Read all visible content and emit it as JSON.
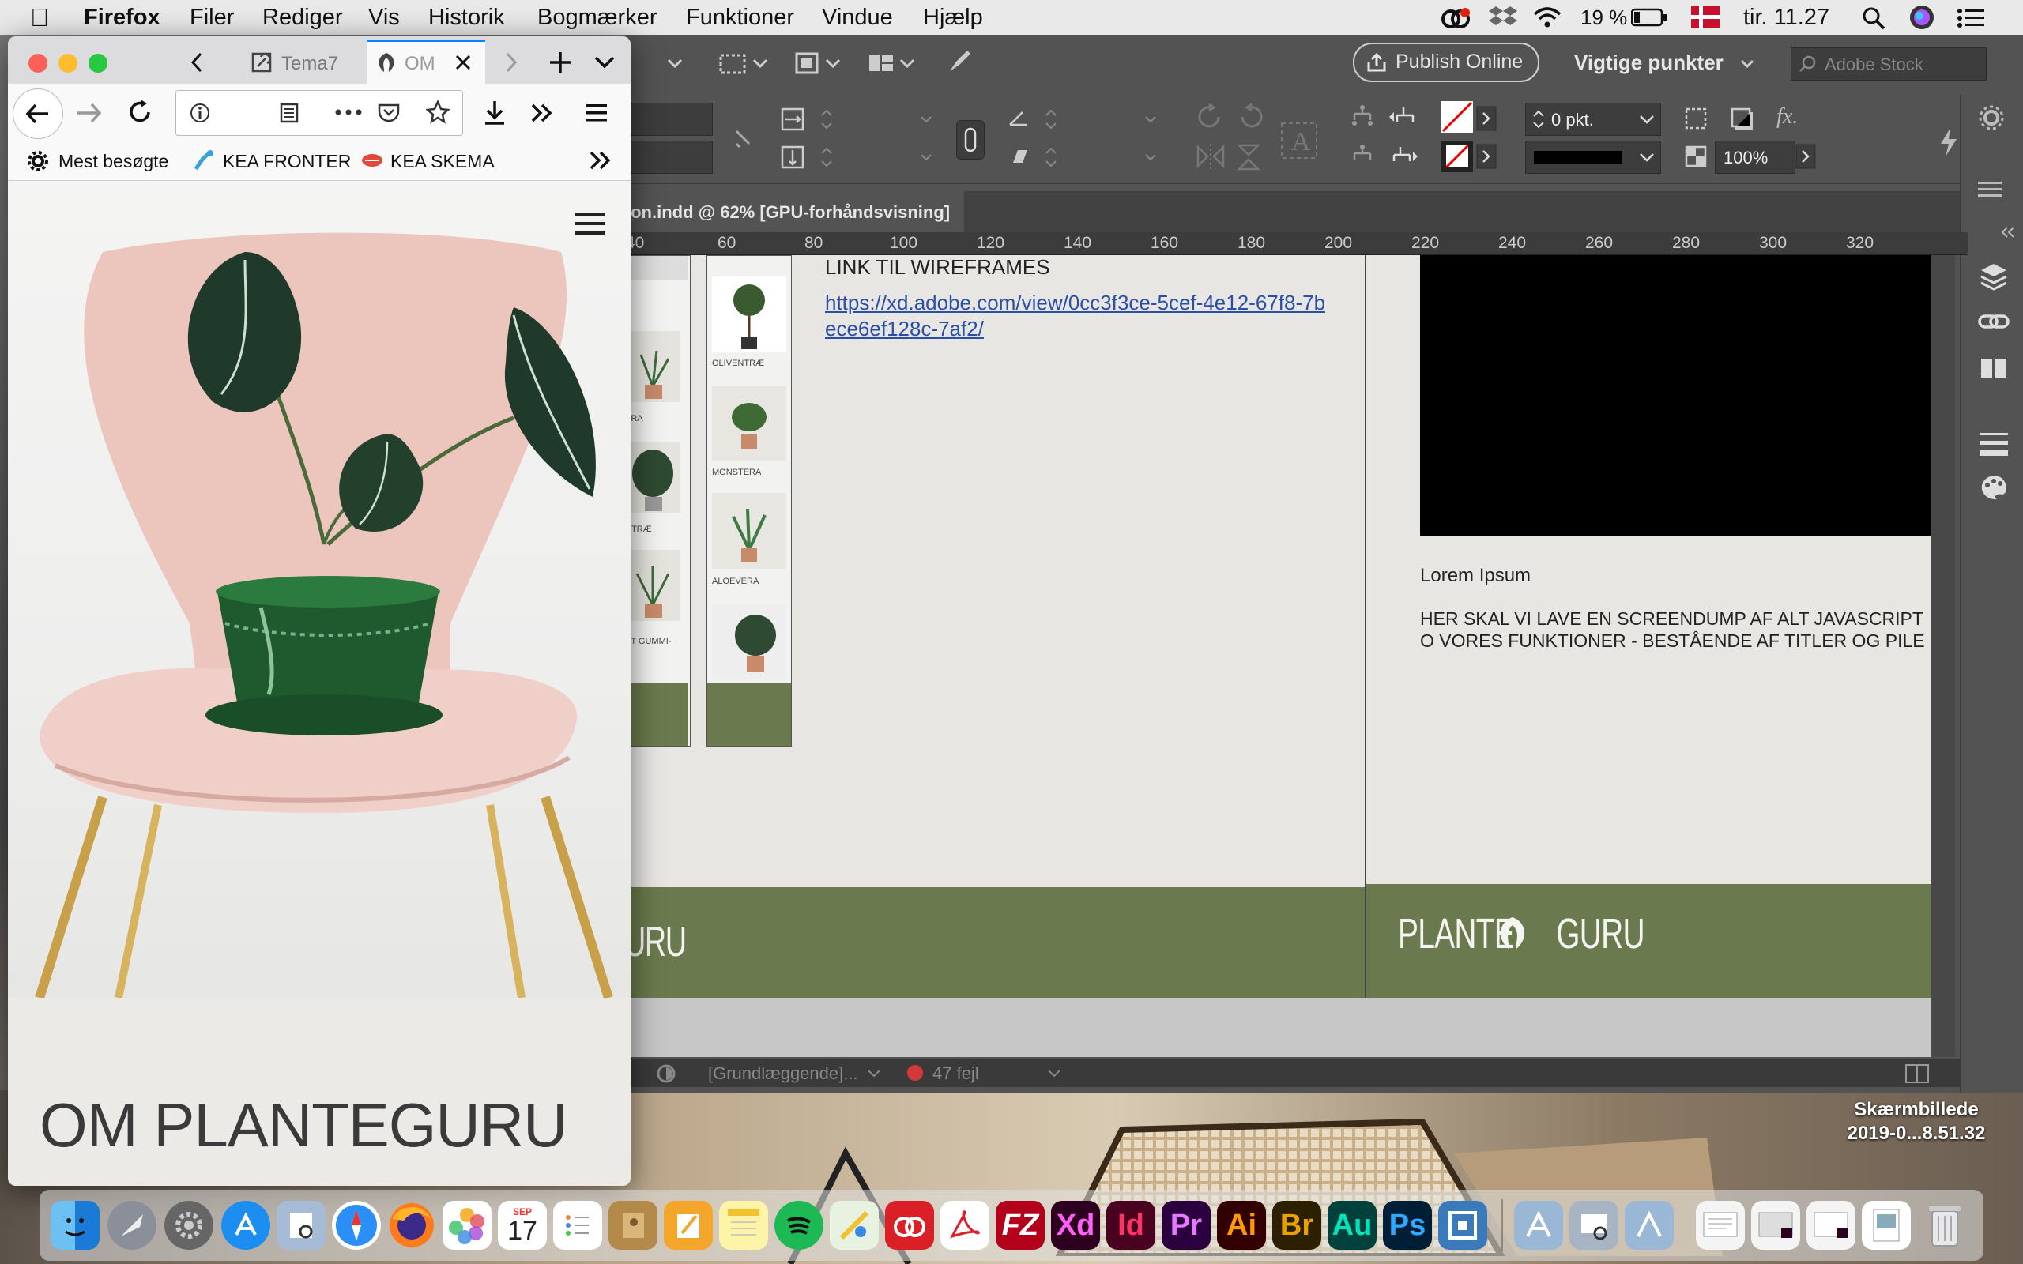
{
  "menubar": {
    "app": "Firefox",
    "items": [
      "Filer",
      "Rediger",
      "Vis",
      "Historik",
      "Bogmærker",
      "Funktioner",
      "Vindue",
      "Hjælp"
    ],
    "battery": "19 %",
    "clock": "tir. 11.27"
  },
  "firefox": {
    "tabs": [
      {
        "label": "Tema7"
      },
      {
        "label": "OM"
      }
    ],
    "bookmarks": [
      "Mest besøgte",
      "KEA FRONTER",
      "KEA SKEMA"
    ],
    "page": {
      "heading": "OM PLANTEGURU"
    }
  },
  "indesign": {
    "publish_label": "Publish Online",
    "workspace": "Vigtige punkter",
    "stock_placeholder": "Adobe Stock",
    "stroke_weight": "0 pkt.",
    "opacity": "100%",
    "doc_tab": "ion.indd @ 62% [GPU-forhåndsvisning]",
    "ruler": [
      "40",
      "60",
      "80",
      "100",
      "120",
      "140",
      "160",
      "180",
      "200",
      "220",
      "240",
      "260",
      "280",
      "300",
      "320"
    ],
    "page_left": {
      "heading": "LINK TIL WIREFRAMES",
      "link": "https://xd.adobe.com/view/0cc3f3ce-5cef-4e12-67f8-7bece6ef128c-7af2/",
      "footer_logo": "URU"
    },
    "page_right": {
      "subtitle": "Lorem Ipsum",
      "body": "HER SKAL VI LAVE EN SCREENDUMP AF ALT JAVASCRIPT O VORES FUNKTIONER - BESTÅENDE AF TITLER OG PILE",
      "footer_logo": "PLANTE GURU"
    },
    "thumb_labels": [
      "OLIVENTRÆ",
      "MONSTERA",
      "ALOEVERA",
      "ERA",
      "NTRÆ",
      "ET GUMMI-"
    ],
    "status": {
      "profile": "[Grundlæggende]...",
      "errors": "47 fejl"
    }
  },
  "desktop_file": {
    "line1": "Skærmbillede",
    "line2": "2019-0...8.51.32"
  },
  "dock": {
    "apps": [
      "Finder",
      "Launchpad",
      "System Preferences",
      "App Store",
      "Preview",
      "Safari",
      "Firefox",
      "Photos",
      "Calendar",
      "Reminders",
      "Notes Book",
      "Pages",
      "Notes",
      "Spotify",
      "Maps",
      "Creative Cloud",
      "Acrobat",
      "FileZilla",
      "Xd",
      "Id",
      "Pr",
      "Ai",
      "Br",
      "Au",
      "Ps",
      "Other"
    ],
    "calendar_date": "17",
    "calendar_month": "SEP"
  }
}
